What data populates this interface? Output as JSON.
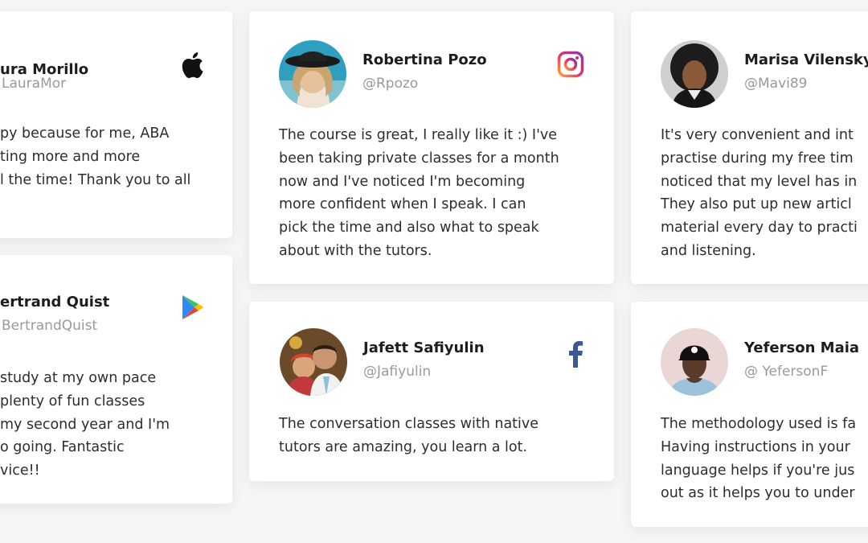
{
  "testimonials": [
    {
      "id": "laura",
      "name": "ura Morillo",
      "handle": "LauraMor",
      "platform": "apple-icon",
      "quote_lines": [
        "py because for me, ABA",
        "ting more and more",
        "l the time! Thank you to all"
      ]
    },
    {
      "id": "robertina",
      "name": "Robertina Pozo",
      "handle": "@Rpozo",
      "platform": "instagram-icon",
      "quote_lines": [
        "The course is great, I really like it :) I've",
        "been taking private classes for a month",
        "now and I've noticed I'm becoming",
        "more confident when I speak. I can",
        "pick the time and also what to speak",
        "about with the tutors."
      ]
    },
    {
      "id": "marisa",
      "name": "Marisa Vilensky",
      "handle": "@Mavi89",
      "platform": "none",
      "quote_lines": [
        "It's very convenient and int",
        "practise during my free tim",
        "noticed that my level has in",
        "They also put up new articl",
        "material every day to practi",
        "and listening."
      ]
    },
    {
      "id": "bertrand",
      "name": "ertrand Quist",
      "handle": "BertrandQuist",
      "platform": "google-play-icon",
      "quote_lines": [
        "study at my own pace",
        "plenty of fun classes",
        "my second year and I'm",
        "o going. Fantastic",
        "vice!!"
      ]
    },
    {
      "id": "jafett",
      "name": "Jafett Safiyulin",
      "handle": "@Jafiyulin",
      "platform": "facebook-icon",
      "quote_lines": [
        "The conversation classes with native",
        "tutors are amazing, you learn a lot."
      ]
    },
    {
      "id": "yeferson",
      "name": "Yeferson Maia",
      "handle": "@ YefersonF",
      "platform": "none",
      "quote_lines": [
        "The methodology used is fa",
        "Having instructions in your",
        "language  helps if you're jus",
        "out as it helps you to under"
      ]
    }
  ],
  "colors": {
    "background": "#f6f6f6",
    "card": "#ffffff",
    "name_text": "#1d1d1d",
    "handle_text": "#9a9a9a",
    "facebook_blue": "#3b5998"
  }
}
